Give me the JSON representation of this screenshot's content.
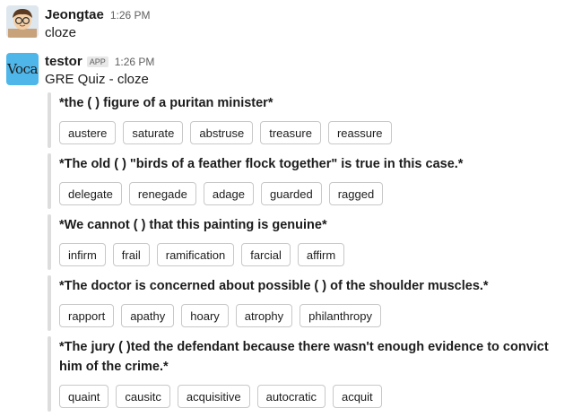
{
  "messages": [
    {
      "author": "Jeongtae",
      "time": "1:26 PM",
      "text": "cloze"
    },
    {
      "author": "testor",
      "badge": "APP",
      "time": "1:26 PM",
      "text": "GRE Quiz - cloze",
      "avatar_text": "Voca"
    }
  ],
  "quizzes": [
    {
      "question": "*the (    ) figure of a puritan minister*",
      "options": [
        "austere",
        "saturate",
        "abstruse",
        "treasure",
        "reassure"
      ]
    },
    {
      "question": "*The old (    ) \"birds of a feather flock together\" is true in this case.*",
      "options": [
        "delegate",
        "renegade",
        "adage",
        "guarded",
        "ragged"
      ]
    },
    {
      "question": "*We cannot (    ) that this painting is genuine*",
      "options": [
        "infirm",
        "frail",
        "ramification",
        "farcial",
        "affirm"
      ]
    },
    {
      "question": "*The doctor is concerned about possible (    ) of the shoulder muscles.*",
      "options": [
        "rapport",
        "apathy",
        "hoary",
        "atrophy",
        "philanthropy"
      ]
    },
    {
      "question": "*The jury (    )ted the defendant because there wasn't enough evidence to convict him of the crime.*",
      "options": [
        "quaint",
        "causitc",
        "acquisitive",
        "autocratic",
        "acquit"
      ]
    }
  ],
  "colors": {
    "avatar_voca_bg": "#4fb6ea",
    "attachment_bar": "#dddddd",
    "button_border": "#c8c8c8"
  }
}
